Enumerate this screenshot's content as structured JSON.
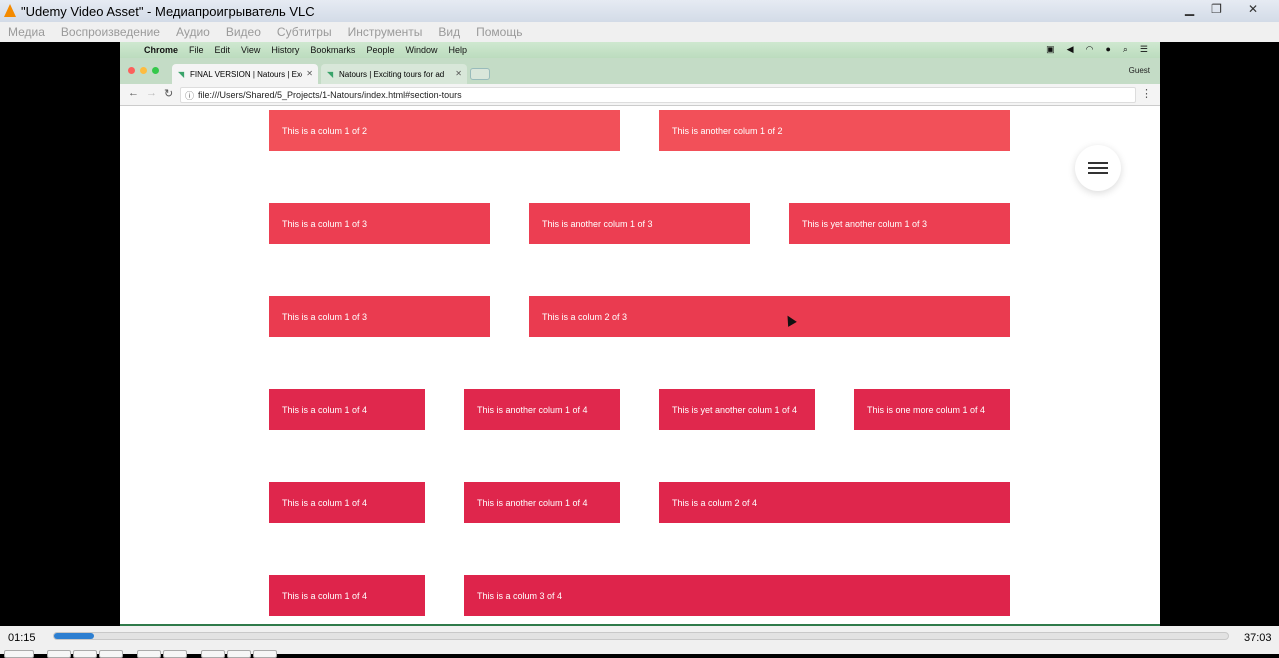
{
  "vlc": {
    "title": "\"Udemy Video Asset\" - Медиапроигрыватель VLC",
    "menu": [
      "Медиа",
      "Воспроизведение",
      "Аудио",
      "Видео",
      "Субтитры",
      "Инструменты",
      "Вид",
      "Помощь"
    ],
    "elapsed": "01:15",
    "total": "37:03",
    "progress_fraction": 0.034
  },
  "mac": {
    "menu": [
      "Chrome",
      "File",
      "Edit",
      "View",
      "History",
      "Bookmarks",
      "People",
      "Window",
      "Help"
    ]
  },
  "chrome": {
    "tabs": [
      {
        "title": "FINAL VERSION | Natours | Exc"
      },
      {
        "title": "Natours | Exciting tours for ad"
      }
    ],
    "guest_label": "Guest",
    "url": "file:///Users/Shared/5_Projects/1-Natours/index.html#section-tours"
  },
  "page": {
    "rows": [
      {
        "color": "#f25059",
        "cells": [
          "This is a colum 1 of 2",
          "This is another colum 1 of 2"
        ]
      },
      {
        "color": "#ec3e52",
        "cells": [
          "This is a colum 1 of 3",
          "This is another colum 1 of 3",
          "This is yet another colum 1 of 3"
        ]
      },
      {
        "color": "#ea3b50",
        "cells": [
          "This is a colum 1 of 3",
          "This is a colum 2 of 3"
        ]
      },
      {
        "color": "#e0284d",
        "cells": [
          "This is a colum 1 of 4",
          "This is another colum 1 of 4",
          "This is yet another colum 1 of 4",
          "This is one more colum 1 of 4"
        ]
      },
      {
        "color": "#df264c",
        "cells": [
          "This is a colum 1 of 4",
          "This is another colum 1 of 4",
          "This is a colum 2 of 4"
        ]
      },
      {
        "color": "#de244b",
        "cells": [
          "This is a colum 1 of 4",
          "This is a colum 3 of 4"
        ]
      }
    ]
  }
}
